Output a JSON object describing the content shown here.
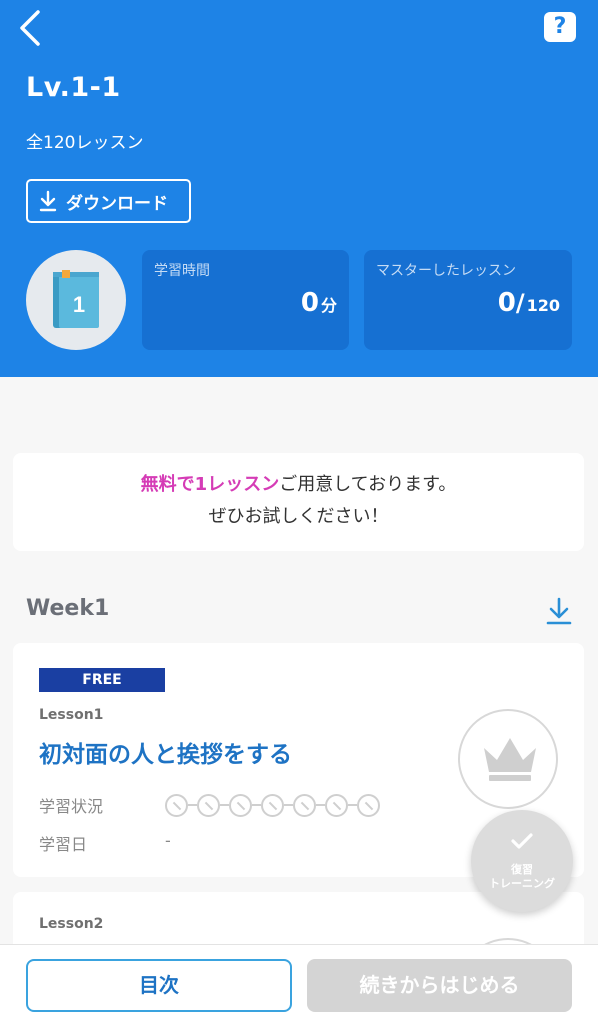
{
  "header": {
    "level_title": "Lv.1-1",
    "lesson_count": "全120レッスン",
    "download_label": "ダウンロード",
    "help_label": "?",
    "book_number": "1"
  },
  "stats": {
    "study_time_label": "学習時間",
    "study_time_value": "0",
    "study_time_unit": "分",
    "mastered_label": "マスターしたレッスン",
    "mastered_value": "0",
    "mastered_total": "120"
  },
  "promo": {
    "highlight": "無料で1レッスン",
    "line1_rest": "ご用意しております。",
    "line2": "ぜひお試しください！"
  },
  "week": {
    "title": "Week1"
  },
  "lessons": [
    {
      "badge": "FREE",
      "label": "Lesson1",
      "title": "初対面の人と挨拶をする",
      "status_label": "学習状況",
      "progress_steps": 7,
      "date_label": "学習日",
      "date_value": "-"
    },
    {
      "label": "Lesson2"
    }
  ],
  "review": {
    "line1": "復習",
    "line2": "トレーニング"
  },
  "bottom": {
    "toc_label": "目次",
    "continue_label": "続きからはじめる"
  },
  "colors": {
    "header_bg": "#1e83e6",
    "stat_card_bg": "#1670d2",
    "promo_highlight": "#d53cb6",
    "lesson_title": "#1e73c4",
    "free_badge": "#1a3fa2"
  }
}
